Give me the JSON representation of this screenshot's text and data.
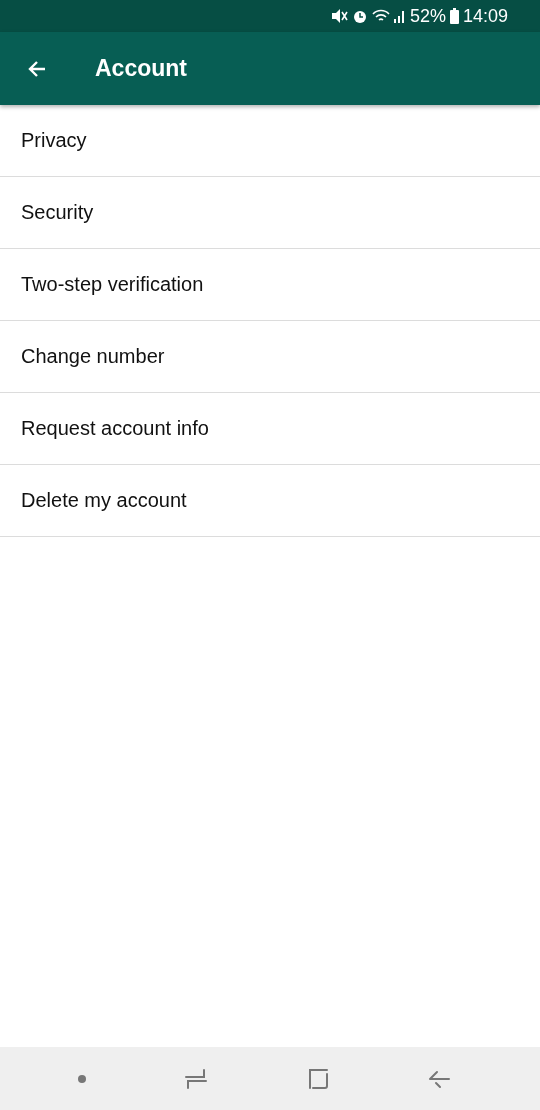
{
  "status_bar": {
    "battery": "52%",
    "time": "14:09"
  },
  "app_bar": {
    "title": "Account"
  },
  "items": [
    {
      "label": "Privacy"
    },
    {
      "label": "Security"
    },
    {
      "label": "Two-step verification"
    },
    {
      "label": "Change number"
    },
    {
      "label": "Request account info"
    },
    {
      "label": "Delete my account"
    }
  ]
}
